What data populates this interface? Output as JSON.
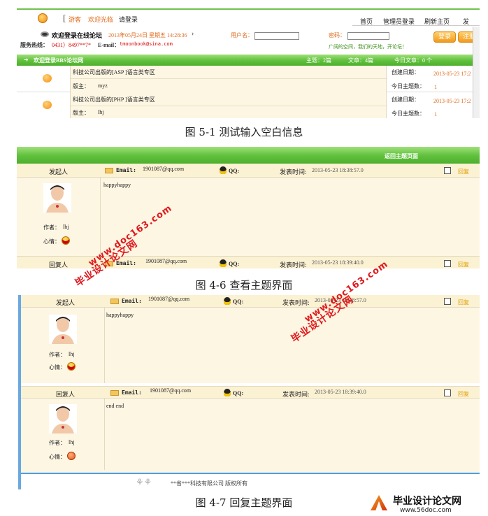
{
  "fig1": {
    "nav_guest_prefix": "[",
    "nav_guest": "游客",
    "nav_welcome": "欢迎光临",
    "nav_login": "请登录",
    "menu": [
      "首页",
      "管理员登录",
      "刷新主页",
      "发"
    ],
    "welcome": "欢迎登录在线论坛",
    "date": "2013年05月24日 星期五 14:28:36",
    "hotline_label": "服务热线：",
    "hotline": "0431）8497**7*",
    "email_label": "E-mail：",
    "email": "tmoonbook@sina.com",
    "username_label": "用户名：",
    "password_label": "密码：",
    "login_btn": "登录",
    "register_btn": "注册",
    "slogan": "广阔的空间，我们的天地，开论坛！",
    "bar_title": "欢迎登录BBS论坛网",
    "bar_topics": "主题：2篇",
    "bar_articles": "文章：4篇",
    "bar_today": "今日文章：0 个",
    "forums": [
      {
        "name": "科技公司出版的[ASP ]语言类专区",
        "moderator_label": "版主：",
        "moderator": "myz",
        "created_label": "创建日期：",
        "created": "2013-05-23 17:2",
        "today_label": "今日主题数：",
        "today": "1"
      },
      {
        "name": "科技公司出版的[PHP ]语言类专区",
        "moderator_label": "版主：",
        "moderator": "lhj",
        "created_label": "创建日期：",
        "created": "2013-05-23 17:2",
        "today_label": "今日主题数：",
        "today": "1"
      }
    ],
    "caption": "图 5-1  测试输入空白信息"
  },
  "fig2": {
    "back_link": "返回主题页面",
    "poster_label": "发起人",
    "email_label": "Email:",
    "email": "1901087@qq.com",
    "qq_label": "QQ:",
    "time_label": "发表时间:",
    "time": "2013-05-23 18:38:57.0",
    "reply_btn": "回复",
    "content": "happyhappy",
    "author_label": "作者：",
    "author": "lhj",
    "mood_label": "心情：",
    "replier_label": "回复人",
    "reply_email": "1901087@qq.com",
    "reply_time": "2013-05-23 18:39:40.0",
    "caption": "图 4-6   查看主题界面"
  },
  "fig3": {
    "poster_label": "发起人",
    "email_label": "Email:",
    "email": "1901087@qq.com",
    "qq_label": "QQ:",
    "time_label": "发表时间:",
    "time": "2013-05-23 18:38:57.0",
    "reply_btn": "回复",
    "content": "happyhappy",
    "author_label": "作者：",
    "author": "lhj",
    "mood_label": "心情：",
    "replier_label": "回复人",
    "reply_email": "1901087@qq.com",
    "reply_time": "2013-05-23 18:39:40.0",
    "reply_content": "end end",
    "footer": "**省***科技有限公司  版权所有",
    "caption": "图 4-7    回复主题界面"
  },
  "watermarks": {
    "brand": "毕业设计论文网",
    "url": "www.doc163.com",
    "corner_brand": "毕业设计论文网",
    "corner_url": "www.56doc.com"
  },
  "colors": {
    "green": "#63c23f",
    "cream": "#fdf6e3",
    "orange": "#e06a1b",
    "watermark": "#e0191e"
  }
}
